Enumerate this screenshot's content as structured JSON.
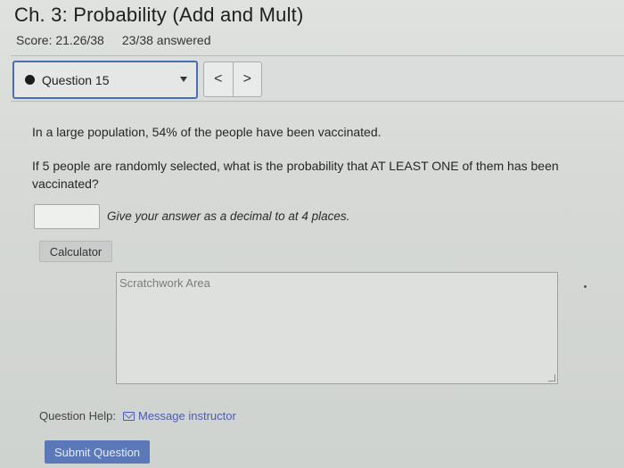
{
  "assignment": {
    "title": "Ch. 3: Probability (Add and Mult)",
    "score": "Score: 21.26/38",
    "answered": "23/38 answered"
  },
  "navigation": {
    "question_label": "Question 15",
    "prev_label": "<",
    "next_label": ">"
  },
  "question": {
    "text1": "In a large population, 54% of the people have been vaccinated.",
    "text2": "If 5 people are randomly selected, what is the probability that AT LEAST ONE of them has been vaccinated?",
    "answer_value": "",
    "answer_hint": "Give your answer as a decimal to at 4 places."
  },
  "tools": {
    "calculator_label": "Calculator",
    "scratch_placeholder": "Scratchwork Area"
  },
  "help": {
    "label": "Question Help:",
    "message_label": "Message instructor"
  },
  "actions": {
    "submit_label": "Submit Question"
  },
  "colors": {
    "accent": "#4a6fb0",
    "submit_bg": "#5b79b9",
    "link": "#4e5bb0"
  },
  "icons": {
    "status_dot": "question-status-dot-icon",
    "dropdown": "chevron-down-icon",
    "mail": "mail-icon"
  }
}
